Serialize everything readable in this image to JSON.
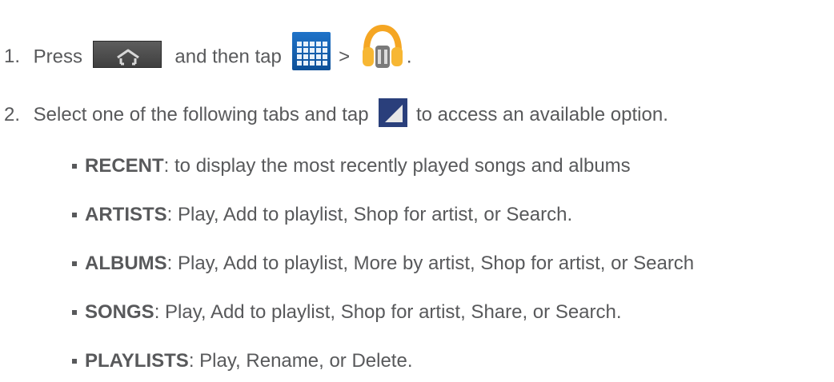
{
  "steps": [
    {
      "number": "1.",
      "text_before_home": "Press",
      "text_after_home": "and then tap",
      "separator": ">",
      "end": "."
    },
    {
      "number": "2.",
      "text_before_icon": "Select one of the following tabs and tap",
      "text_after_icon": "to access an available option."
    }
  ],
  "tabs": [
    {
      "name": "RECENT",
      "desc": ": to display the most recently played songs and albums"
    },
    {
      "name": "ARTISTS",
      "desc": ": Play, Add to playlist, Shop for artist, or Search."
    },
    {
      "name": "ALBUMS",
      "desc": ": Play, Add to playlist, More by artist, Shop for artist, or Search"
    },
    {
      "name": "SONGS",
      "desc": ": Play, Add to playlist, Shop for artist, Share, or Search."
    },
    {
      "name": "PLAYLISTS",
      "desc": ": Play, Rename, or Delete."
    }
  ],
  "icons": {
    "home": "home-key-icon",
    "apps": "apps-launcher-icon",
    "music": "play-music-icon",
    "menu": "menu-corner-icon"
  },
  "colors": {
    "text": "#58595b",
    "apps_blue": "#1f73c9",
    "music_orange": "#f5a623",
    "menu_navy": "#2a3f7b"
  }
}
